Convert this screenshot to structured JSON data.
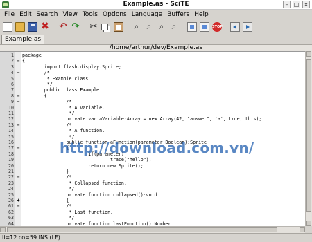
{
  "window": {
    "title": "Example.as - SciTE"
  },
  "menu": [
    {
      "label": "File",
      "key": "F"
    },
    {
      "label": "Edit",
      "key": "E"
    },
    {
      "label": "Search",
      "key": "S"
    },
    {
      "label": "View",
      "key": "V"
    },
    {
      "label": "Tools",
      "key": "T"
    },
    {
      "label": "Options",
      "key": "O"
    },
    {
      "label": "Language",
      "key": "L"
    },
    {
      "label": "Buffers",
      "key": "B"
    },
    {
      "label": "Help",
      "key": "H"
    }
  ],
  "toolbar": [
    {
      "name": "new-icon"
    },
    {
      "name": "open-icon"
    },
    {
      "name": "save-icon"
    },
    {
      "name": "close-icon"
    },
    {
      "name": "undo-icon"
    },
    {
      "name": "redo-icon"
    },
    {
      "name": "cut-icon"
    },
    {
      "name": "copy-icon"
    },
    {
      "name": "paste-icon"
    },
    {
      "name": "find-icon"
    },
    {
      "name": "find-next-icon"
    },
    {
      "name": "replace-icon"
    },
    {
      "name": "goto-icon"
    },
    {
      "name": "compile-icon"
    },
    {
      "name": "build-icon"
    },
    {
      "name": "stop-icon",
      "text": "STOP"
    },
    {
      "name": "prev-buffer-icon"
    },
    {
      "name": "next-buffer-icon"
    }
  ],
  "tab": {
    "label": "Example.as"
  },
  "path": "/home/arthur/dev/Example.as",
  "editor": {
    "lines": [
      {
        "n": "1",
        "fold": "",
        "text": "package"
      },
      {
        "n": "2",
        "fold": "−",
        "text": "{"
      },
      {
        "n": "3",
        "fold": "",
        "text": "        import flash.display.Sprite;"
      },
      {
        "n": "4",
        "fold": "−",
        "text": "        /*"
      },
      {
        "n": "5",
        "fold": "",
        "text": "         * Example class"
      },
      {
        "n": "6",
        "fold": "",
        "text": "         */"
      },
      {
        "n": "7",
        "fold": "",
        "text": "        public class Example"
      },
      {
        "n": "8",
        "fold": "−",
        "text": "        {"
      },
      {
        "n": "9",
        "fold": "−",
        "text": "                /*"
      },
      {
        "n": "10",
        "fold": "",
        "text": "                 * A variable."
      },
      {
        "n": "11",
        "fold": "",
        "text": "                 */"
      },
      {
        "n": "12",
        "fold": "",
        "text": "                private var aVariable:Array = new Array(42, \"answer\", 'a', true, this);"
      },
      {
        "n": "13",
        "fold": "−",
        "text": "                /*"
      },
      {
        "n": "14",
        "fold": "",
        "text": "                 * A function."
      },
      {
        "n": "15",
        "fold": "",
        "text": "                 */"
      },
      {
        "n": "16",
        "fold": "",
        "text": "                public function aFunction(parameter:Boolean):Sprite"
      },
      {
        "n": "17",
        "fold": "−",
        "text": "                {"
      },
      {
        "n": "18",
        "fold": "",
        "text": "                        if(parameter)"
      },
      {
        "n": "19",
        "fold": "",
        "text": "                                trace(\"hello\");"
      },
      {
        "n": "20",
        "fold": "",
        "text": "                        return new Sprite();"
      },
      {
        "n": "21",
        "fold": "",
        "text": "                }"
      },
      {
        "n": "22",
        "fold": "−",
        "text": "                /*"
      },
      {
        "n": "23",
        "fold": "",
        "text": "                 * Collapsed function."
      },
      {
        "n": "24",
        "fold": "",
        "text": "                 */"
      },
      {
        "n": "25",
        "fold": "",
        "text": "                private function collapsed():void"
      },
      {
        "n": "26",
        "fold": "+",
        "text": "                {"
      },
      {
        "n": "61",
        "fold": "−",
        "text": "                /*"
      },
      {
        "n": "62",
        "fold": "",
        "text": "                 * Last function."
      },
      {
        "n": "63",
        "fold": "",
        "text": "                 */"
      },
      {
        "n": "64",
        "fold": "",
        "text": "                private function lastFunction():Number"
      }
    ]
  },
  "watermark": "http://download.com.vn/",
  "status": {
    "text": "li=12 co=59 INS (LF)"
  }
}
